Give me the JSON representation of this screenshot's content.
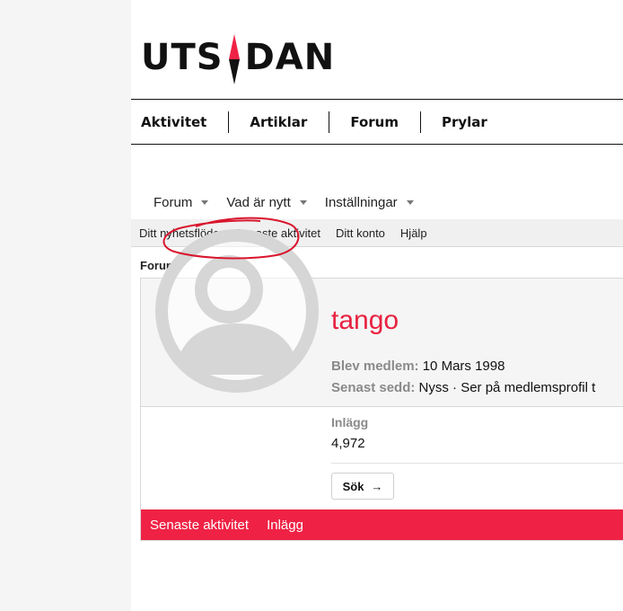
{
  "brand": {
    "name_left": "UTS",
    "name_right": "DAN"
  },
  "main_nav": [
    "Aktivitet",
    "Artiklar",
    "Forum",
    "Prylar"
  ],
  "forum_tabs": [
    "Forum",
    "Vad är nytt",
    "Inställningar"
  ],
  "sub_links": [
    "Ditt nyhetsflöde",
    "Senaste aktivitet",
    "Ditt konto",
    "Hjälp"
  ],
  "breadcrumb": "Forum",
  "profile": {
    "username": "tango",
    "joined_label": "Blev medlem:",
    "joined_value": "10 Mars 1998",
    "seen_label": "Senast sedd:",
    "seen_value": "Nyss · Ser på medlemsprofil t",
    "posts_label": "Inlägg",
    "posts_value": "4,972",
    "search_label": "Sök",
    "search_arrow": "→"
  },
  "profile_tabs": [
    "Senaste aktivitet",
    "Inlägg"
  ],
  "colors": {
    "accent": "#ef2245",
    "username": "#e8213f",
    "annotation": "#d9162d"
  },
  "icons": [
    "compass-icon",
    "caret-down-icon",
    "arrow-right-icon",
    "default-avatar-icon"
  ]
}
